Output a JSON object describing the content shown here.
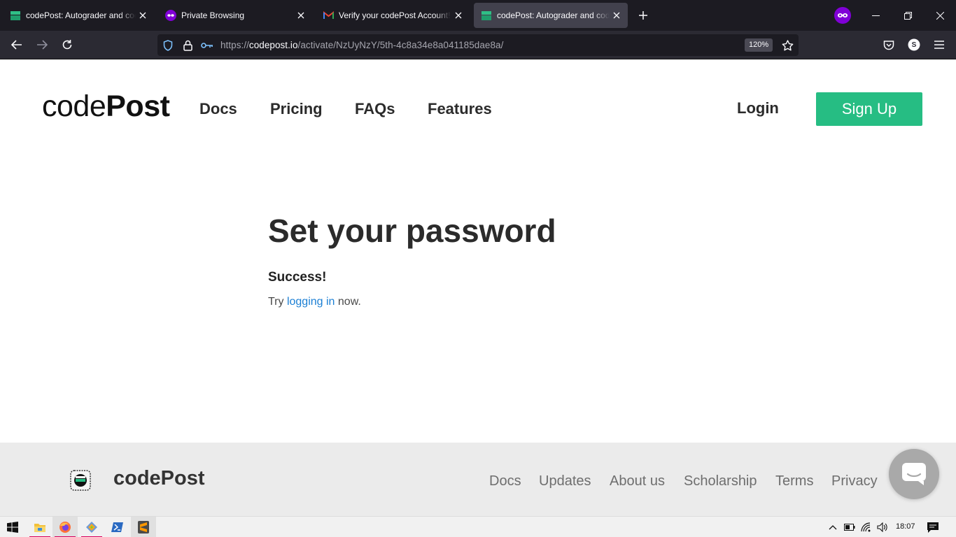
{
  "browser": {
    "tabs": [
      {
        "title": "codePost: Autograder and code review for CS courses",
        "favicon": "codepost-favicon",
        "active": false
      },
      {
        "title": "Private Browsing",
        "favicon": "private-browsing-mask-icon",
        "active": false
      },
      {
        "title": "Verify your codePost Account! - Gmail",
        "favicon": "gmail-icon",
        "active": false
      },
      {
        "title": "codePost: Autograder and code review for CS courses",
        "favicon": "codepost-favicon",
        "active": true
      }
    ],
    "url_prefix": "https://",
    "url_domain": "codepost.io",
    "url_path": "/activate/NzUyNzY/5th-4c8a34e8a041185dae8a/",
    "zoom": "120%",
    "account_initial": "S",
    "colors": {
      "tabstrip": "#1c1b22",
      "toolbar": "#2b2a33",
      "private_badge": "#8000d7"
    }
  },
  "header": {
    "logo_light": "code",
    "logo_bold": "Post",
    "nav": [
      "Docs",
      "Pricing",
      "FAQs",
      "Features"
    ],
    "login": "Login",
    "signup": "Sign Up",
    "accent": "#26bd83"
  },
  "main": {
    "title": "Set your password",
    "status": "Success!",
    "message_before": "Try ",
    "link_text": "logging in",
    "message_after": " now."
  },
  "footer": {
    "brand": "codePost",
    "links": [
      "Docs",
      "Updates",
      "About us",
      "Scholarship",
      "Terms",
      "Privacy"
    ]
  },
  "taskbar": {
    "apps": [
      "start-icon",
      "file-explorer-icon",
      "firefox-icon",
      "app-icon",
      "powershell-icon",
      "sublime-text-icon"
    ],
    "time": "18:07"
  }
}
